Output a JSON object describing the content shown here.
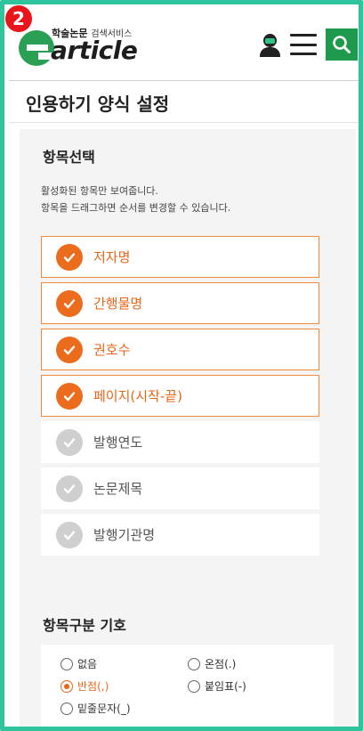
{
  "badge": "2",
  "header": {
    "logo_sub_bold": "학술논문",
    "logo_sub_thin": "검색서비스",
    "logo_word": "article",
    "icons": [
      "user-icon",
      "menu-icon",
      "search-icon"
    ],
    "brand_color": "#1d9a4c"
  },
  "page_title": "인용하기 양식 설정",
  "items_section": {
    "title": "항목선택",
    "desc_line1": "활성화된 항목만 보여줍니다.",
    "desc_line2": "항목을 드래그하면 순서를 변경할 수 있습니다.",
    "items": [
      {
        "label": "저자명",
        "active": true
      },
      {
        "label": "간행물명",
        "active": true
      },
      {
        "label": "권호수",
        "active": true
      },
      {
        "label": "페이지(시작-끝)",
        "active": true
      },
      {
        "label": "발행연도",
        "active": false
      },
      {
        "label": "논문제목",
        "active": false
      },
      {
        "label": "발행기관명",
        "active": false
      }
    ],
    "active_color": "#ec6c1d"
  },
  "symbol_section": {
    "title": "항목구분 기호",
    "options": [
      {
        "label": "없음",
        "selected": false
      },
      {
        "label": "온점(.)",
        "selected": false
      },
      {
        "label": "반점(,)",
        "selected": true
      },
      {
        "label": "붙임표(-)",
        "selected": false
      },
      {
        "label": "밑줄문자(_)",
        "selected": false
      }
    ]
  }
}
